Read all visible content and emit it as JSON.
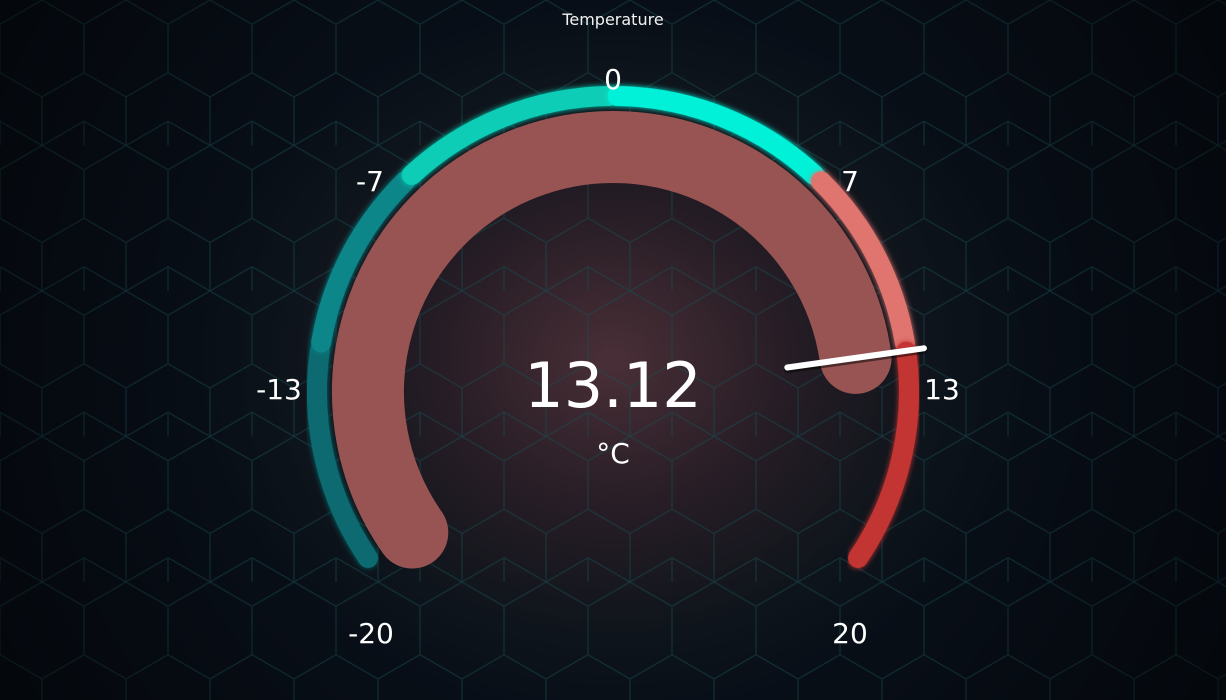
{
  "widget": {
    "title": "Temperature",
    "value_text": "13.12",
    "unit": "°C"
  },
  "gauge": {
    "min": -20,
    "max": 20,
    "value": 13.12,
    "tick_labels": [
      "-20",
      "-13",
      "-7",
      "0",
      "7",
      "13",
      "20"
    ],
    "segments": [
      {
        "from": -20,
        "to": -13,
        "color": "#0a6b70"
      },
      {
        "from": -13,
        "to": -7,
        "color": "#11868a"
      },
      {
        "from": -7,
        "to": 0,
        "color": "#08cdb6"
      },
      {
        "from": 0,
        "to": 7,
        "color": "#00f0d8"
      },
      {
        "from": 7,
        "to": 13,
        "color": "#e07470"
      },
      {
        "from": 13,
        "to": 20,
        "color": "#c23432"
      }
    ],
    "value_bar_color": "#975452",
    "needle_color": "#ffffff"
  },
  "colors": {
    "background": "#0b1118",
    "hex_grid": "#1a4a50",
    "text": "#ffffff"
  }
}
